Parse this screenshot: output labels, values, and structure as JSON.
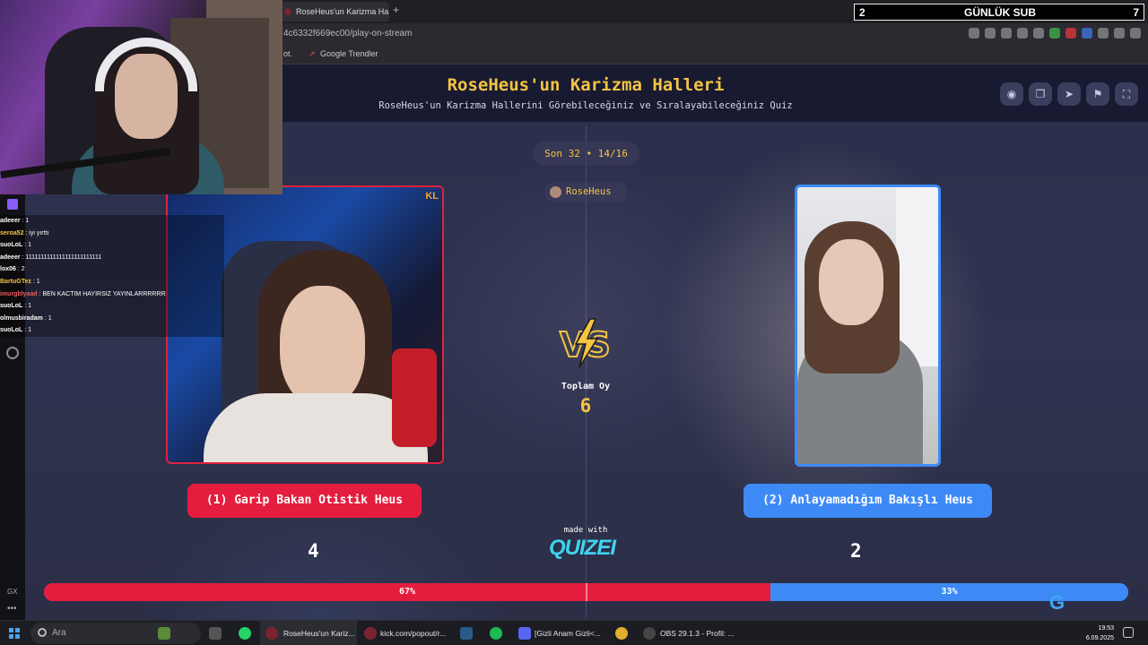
{
  "browser": {
    "tab_title": "RoseHeus'un Karizma Ha",
    "url": "4c6332f669ec00/play-on-stream",
    "bookmarks": [
      "Google Trendler"
    ],
    "bookmark_prefix": "ot."
  },
  "sub_overlay": {
    "left": "2",
    "center": "GÜNLÜK SUB",
    "right": "7"
  },
  "quiz": {
    "title": "RoseHeus'un Karizma Halleri",
    "subtitle": "RoseHeus'un Karizma Hallerini Görebileceğiniz ve Sıralayabileceğiniz Quiz",
    "round": "Son 32 • 14/16",
    "author": "RoseHeus",
    "total_label": "Toplam Oy",
    "total_votes": "6",
    "made_with": "made with",
    "brand": "QUIZEI",
    "left": {
      "label": "(1) Garip Bakan Otistik Heus",
      "votes": "4",
      "percent_label": "67%",
      "share": 0.67,
      "color": "#e41d3e"
    },
    "right": {
      "label": "(2) Anlayamadığım Bakışlı Heus",
      "votes": "2",
      "percent_label": "33%",
      "share": 0.33,
      "color": "#3d8af7"
    },
    "card_logo": "KL"
  },
  "chat": [
    {
      "user": "adeeer",
      "msg": ": 1",
      "color": "#ffffff"
    },
    {
      "user": "seroa52",
      "msg": ": iyi yırttı",
      "color": "#f5c443"
    },
    {
      "user": "suoLoL",
      "msg": ": 1",
      "color": "#ffffff"
    },
    {
      "user": "adeeer",
      "msg": ": 1111111111111111111111111",
      "color": "#ffffff"
    },
    {
      "user": "lox06",
      "msg": ": 2",
      "color": "#ffffff"
    },
    {
      "user": "BartuGTez",
      "msg": ": 1",
      "color": "#f5c443"
    },
    {
      "user": "imurgblyaad",
      "msg": ": BEN KACTIM HAYIRSIZ YAYINLARRRRRR",
      "color": "#e65d5d"
    },
    {
      "user": "suoLoL",
      "msg": ": 1",
      "color": "#ffffff"
    },
    {
      "user": "olmusbiradam",
      "msg": ": 1",
      "color": "#ffffff"
    },
    {
      "user": "suoLoL",
      "msg": ": 1",
      "color": "#ffffff"
    }
  ],
  "sidebar": {
    "gx": "GX",
    "more": "•••"
  },
  "logitech": {
    "short": "G",
    "name": "logitech"
  },
  "taskbar": {
    "search_placeholder": "Ara",
    "items": [
      {
        "label": "RoseHeus'un Kariz...",
        "icon": "opera-icon"
      },
      {
        "label": "kick.com/popout/r...",
        "icon": "opera-icon"
      },
      {
        "label": "[Gizli Anam Gizli<...",
        "icon": "discord-icon"
      },
      {
        "label": "OBS 29.1.3 - Profil: ...",
        "icon": "obs-icon"
      }
    ],
    "time": "19:53",
    "date": "6.09.2025"
  }
}
